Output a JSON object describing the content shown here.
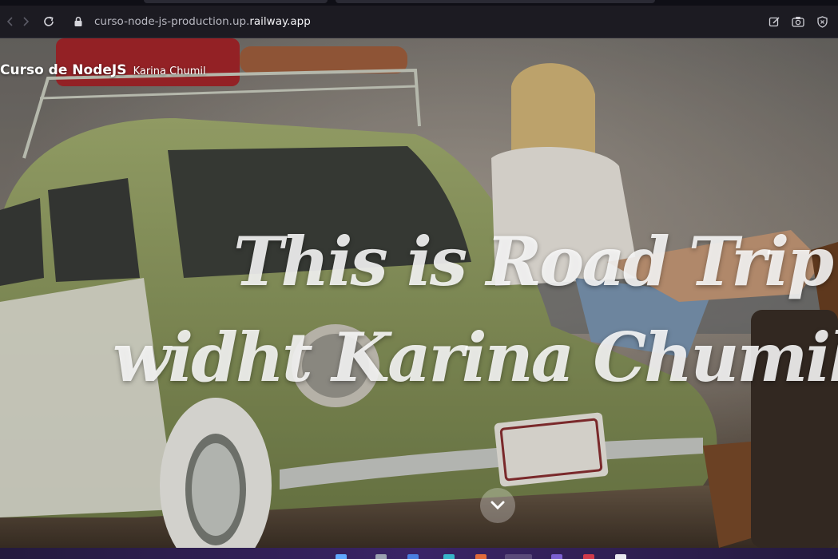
{
  "browser": {
    "url_prefix": "curso-node-js-production.up.",
    "url_domain": "railway.app",
    "nav_icons": [
      "back-icon",
      "forward-icon",
      "reload-icon",
      "lock-icon"
    ],
    "toolbar_icons": [
      "edit-icon",
      "screenshot-icon",
      "shield-icon"
    ]
  },
  "site": {
    "brand_main": "Curso de NodeJS",
    "brand_sub": "Karina Chumil"
  },
  "hero": {
    "title_line1": "This is Road Trip",
    "title_line2": "widht Karina Chumil",
    "scroll_icon": "chevron-down-icon"
  },
  "colors": {
    "toolbar_bg": "#1c1b22",
    "title_color": "#fafafa",
    "taskbar_accent": "#3a2466"
  }
}
